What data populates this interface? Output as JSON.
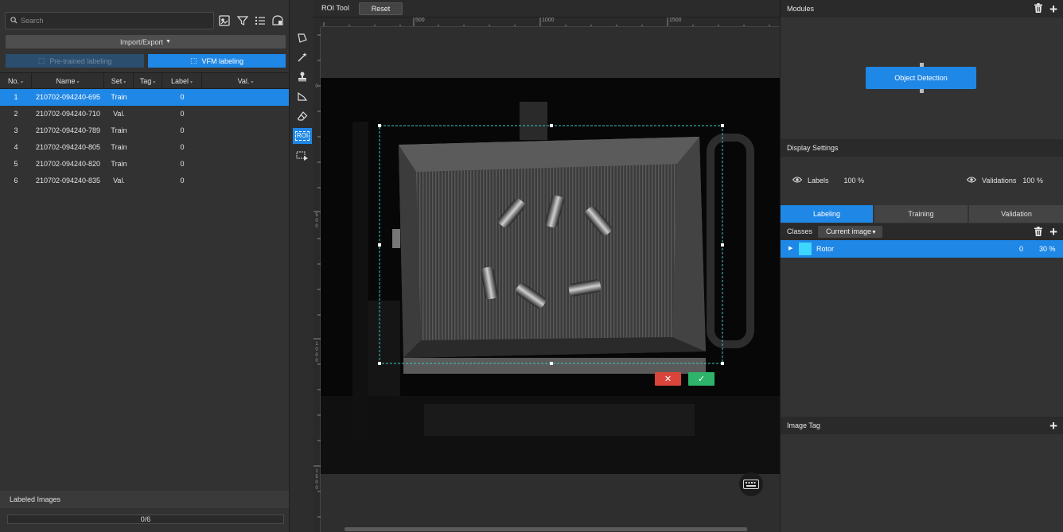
{
  "left_panel": {
    "search_placeholder": "Search",
    "import_export_label": "Import/Export",
    "pretrained_label": "Pre-trained labeling",
    "vfm_label": "VFM labeling",
    "columns": {
      "no": "No.",
      "name": "Name",
      "set": "Set",
      "tag": "Tag",
      "label": "Label",
      "val": "Val."
    },
    "rows": [
      {
        "no": "1",
        "name": "210702-094240-695",
        "set": "Train",
        "tag": "",
        "label": "0",
        "val": ""
      },
      {
        "no": "2",
        "name": "210702-094240-710",
        "set": "Val.",
        "tag": "",
        "label": "0",
        "val": ""
      },
      {
        "no": "3",
        "name": "210702-094240-789",
        "set": "Train",
        "tag": "",
        "label": "0",
        "val": ""
      },
      {
        "no": "4",
        "name": "210702-094240-805",
        "set": "Train",
        "tag": "",
        "label": "0",
        "val": ""
      },
      {
        "no": "5",
        "name": "210702-094240-820",
        "set": "Train",
        "tag": "",
        "label": "0",
        "val": ""
      },
      {
        "no": "6",
        "name": "210702-094240-835",
        "set": "Val.",
        "tag": "",
        "label": "0",
        "val": ""
      }
    ],
    "selected_row": 0,
    "labeled_images_title": "Labeled Images",
    "labeled_progress": "0/6"
  },
  "toolbar": {
    "roi_tool_label": "ROI Tool",
    "reset_label": "Reset"
  },
  "tools": {
    "roi_label": "ROI"
  },
  "ruler": {
    "h_labels": [
      "500",
      "1000",
      "1500"
    ],
    "v_labels": [
      "0",
      "500",
      "1000",
      "1500"
    ]
  },
  "canvas": {
    "cancel_symbol": "✕",
    "confirm_symbol": "✓"
  },
  "right_panel": {
    "modules_title": "Modules",
    "module_node_label": "Object Detection",
    "display_settings_title": "Display Settings",
    "labels_text": "Labels",
    "labels_pct": "100 %",
    "validations_text": "Validations",
    "validations_pct": "100 %",
    "tabs": [
      "Labeling",
      "Training",
      "Validation"
    ],
    "active_tab": 0,
    "classes_label": "Classes",
    "class_filter": "Current image",
    "class_rows": [
      {
        "name": "Rotor",
        "count": "0",
        "pct": "30 %",
        "color": "#3dd6ff"
      }
    ],
    "image_tag_title": "Image Tag"
  },
  "colors": {
    "accent": "#1f87e6",
    "cancel": "#d9453b",
    "confirm": "#2db36a",
    "roi_border": "#37c7c7"
  },
  "icons": [
    "search-icon",
    "image-filter-icon",
    "funnel-icon",
    "list-icon",
    "panel-icon",
    "trash-icon",
    "plus-icon",
    "eye-icon",
    "keyboard-icon"
  ]
}
